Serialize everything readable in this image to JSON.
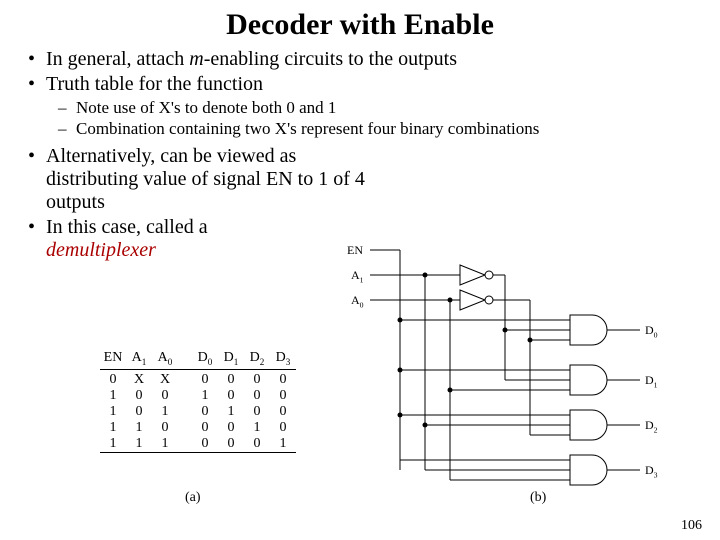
{
  "title": "Decoder with Enable",
  "bullets": {
    "b1": "In general, attach ",
    "b1_italic": "m",
    "b1_rest": "-enabling circuits to the outputs",
    "b2": "Truth table for the function",
    "b2a": "Note use of X's to denote both 0 and 1",
    "b2b": "Combination containing two X's represent four binary combinations",
    "b3": "Alternatively, can be viewed as distributing value of signal EN to 1 of 4 outputs",
    "b4": "In this case, called a ",
    "b4_red": "demultiplexer"
  },
  "chart_data": {
    "type": "table",
    "headers": [
      "EN",
      "A1",
      "A0",
      "D0",
      "D1",
      "D2",
      "D3"
    ],
    "rows": [
      [
        "0",
        "X",
        "X",
        "0",
        "0",
        "0",
        "0"
      ],
      [
        "1",
        "0",
        "0",
        "1",
        "0",
        "0",
        "0"
      ],
      [
        "1",
        "0",
        "1",
        "0",
        "1",
        "0",
        "0"
      ],
      [
        "1",
        "1",
        "0",
        "0",
        "0",
        "1",
        "0"
      ],
      [
        "1",
        "1",
        "1",
        "0",
        "0",
        "0",
        "1"
      ]
    ]
  },
  "circuit_labels": {
    "en": "EN",
    "a1": "A",
    "a1_sub": "1",
    "a0": "A",
    "a0_sub": "0",
    "d0": "D",
    "d1": "D",
    "d2": "D",
    "d3": "D"
  },
  "captions": {
    "a": "(a)",
    "b": "(b)"
  },
  "pagenum": "106"
}
